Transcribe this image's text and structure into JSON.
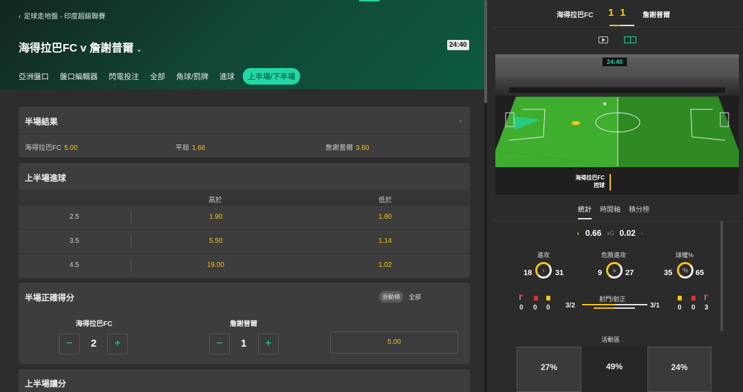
{
  "header": {
    "breadcrumb": "足球走地盤 - 印度超級聯賽",
    "match_title": "海得拉巴FC v 詹謝普爾",
    "clock": "24:40",
    "tabs": [
      {
        "label": "亞洲盤口",
        "active": false
      },
      {
        "label": "盤口編輯器",
        "active": false
      },
      {
        "label": "閃電投注",
        "active": false
      },
      {
        "label": "全部",
        "active": false
      },
      {
        "label": "角球/罰牌",
        "active": false
      },
      {
        "label": "進球",
        "active": false
      },
      {
        "label": "上半場/下半場",
        "active": true
      }
    ]
  },
  "half_time_result": {
    "title": "半場結果",
    "home": {
      "label": "海得拉巴FC",
      "odds": "5.00"
    },
    "draw": {
      "label": "平局",
      "odds": "1.66"
    },
    "away": {
      "label": "詹謝普爾",
      "odds": "3.60"
    }
  },
  "first_half_goals": {
    "title": "上半場進球",
    "col_over": "高於",
    "col_under": "低於",
    "rows": [
      {
        "line": "2.5",
        "over": "1.90",
        "under": "1.80"
      },
      {
        "line": "3.5",
        "over": "5.50",
        "under": "1.14"
      },
      {
        "line": "4.5",
        "over": "19.00",
        "under": "1.02"
      }
    ]
  },
  "half_correct_score": {
    "title": "半場正確得分",
    "slider_chip": "滑動條",
    "all_link": "全部",
    "home_team": "海得拉巴FC",
    "away_team": "詹謝普爾",
    "home_score": "2",
    "away_score": "1",
    "minus": "−",
    "plus": "+",
    "odds": "5.00"
  },
  "first_half_handicap": {
    "title": "上半場讓分"
  },
  "right": {
    "home_team": "海得拉巴FC",
    "away_team": "詹謝普爾",
    "home_score": "1",
    "away_score": "1",
    "stadium_clock": "24:40",
    "possession_team": "海得拉巴FC",
    "possession_text": "控球",
    "tabs": [
      {
        "label": "統計",
        "active": true
      },
      {
        "label": "時間軸",
        "active": false
      },
      {
        "label": "積分榜",
        "active": false
      }
    ],
    "xg": {
      "home": "0.66",
      "label": "xG",
      "away": "0.02"
    },
    "attacks": {
      "label": "進攻",
      "home": "18",
      "away": "31"
    },
    "dangerous_attacks": {
      "label": "危險進攻",
      "home": "9",
      "away": "27"
    },
    "possession_pct": {
      "label": "球權%",
      "home": "35",
      "away": "65"
    },
    "corners": {
      "home": "0",
      "away": "3"
    },
    "red_cards": {
      "home": "0",
      "away": "0"
    },
    "yellow_cards": {
      "home": "0",
      "away": "0"
    },
    "shots": {
      "label": "射門/射正",
      "home": "3/2",
      "away": "3/1"
    },
    "zones": {
      "label": "活動區",
      "left": "27%",
      "middle": "49%",
      "right": "24%"
    }
  },
  "colors": {
    "accent": "#1fd8a5",
    "odds": "#f5c518",
    "card_bg": "#3c3d3c"
  }
}
